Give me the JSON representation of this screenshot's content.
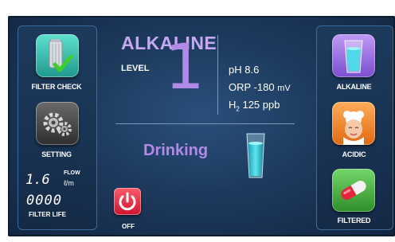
{
  "mode": {
    "title": "ALKALINE",
    "level_label": "LEVEL",
    "level_value": "1",
    "dispense_state": "Drinking"
  },
  "readings": {
    "ph_label": "pH",
    "ph_value": "8.6",
    "orp_label": "ORP",
    "orp_value": "-180",
    "orp_unit": "mV",
    "h2_label": "H",
    "h2_sub": "2",
    "h2_value": "125",
    "h2_unit": "ppb"
  },
  "left_panel": {
    "filter_check_label": "FILTER CHECK",
    "setting_label": "SETTING",
    "flow_value": "1.6",
    "flow_label_line1": "FLOW",
    "flow_unit": "ℓ/m",
    "filter_life_value": "0000",
    "filter_life_label": "FILTER LIFE"
  },
  "right_panel": {
    "alkaline_label": "ALKALINE",
    "acidic_label": "ACIDIC",
    "filtered_label": "FILTERED"
  },
  "power": {
    "label": "OFF"
  },
  "icons": {
    "filter_check": "filter-cartridge-check-icon",
    "setting": "gears-icon",
    "alkaline": "water-glass-icon",
    "acidic": "face-mask-icon",
    "filtered": "capsule-icon",
    "power": "power-icon",
    "glass": "water-glass-icon"
  },
  "colors": {
    "accent_purple": "#b08ae6",
    "filter_tile": "#2fb7a8",
    "setting_tile": "#4a4a4a",
    "alkaline_tile": "#9b6fe0",
    "acidic_tile": "#f07d20",
    "filtered_tile": "#3fa43a",
    "power_button": "#e0223a"
  }
}
